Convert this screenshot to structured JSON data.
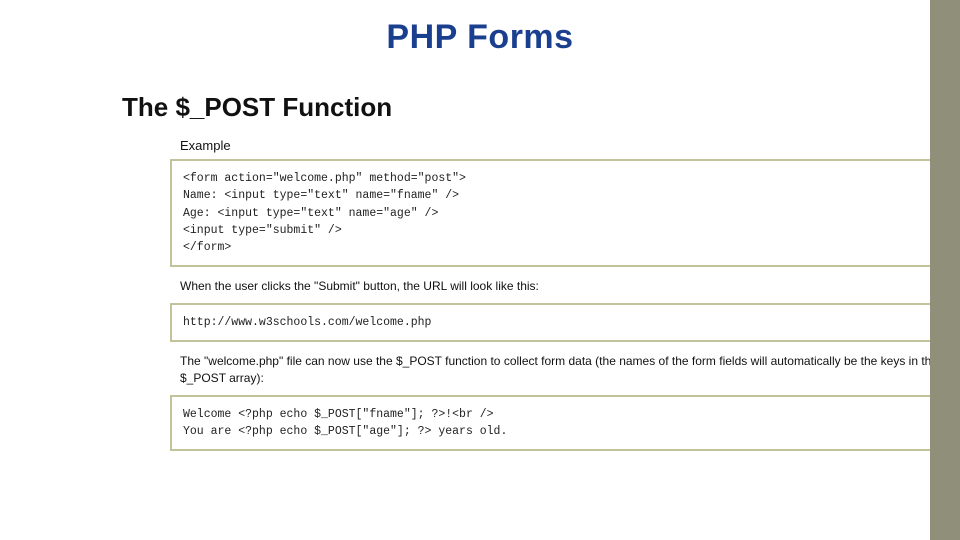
{
  "title": "PHP Forms",
  "subtitle": "The $_POST Function",
  "exampleLabel": "Example",
  "code1": "<form action=\"welcome.php\" method=\"post\">\nName: <input type=\"text\" name=\"fname\" />\nAge: <input type=\"text\" name=\"age\" />\n<input type=\"submit\" />\n</form>",
  "desc1": "When the user clicks the \"Submit\" button, the URL will look like this:",
  "code2": "http://www.w3schools.com/welcome.php",
  "desc2": "The \"welcome.php\" file can now use the $_POST function to collect form data (the names of the form fields will automatically be the keys in the $_POST array):",
  "code3": "Welcome <?php echo $_POST[\"fname\"]; ?>!<br />\nYou are <?php echo $_POST[\"age\"]; ?> years old."
}
